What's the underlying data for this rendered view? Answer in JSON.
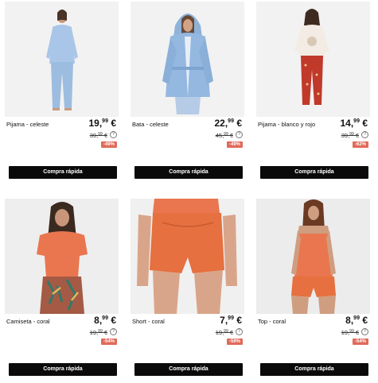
{
  "products": [
    {
      "name": "Pijama - celeste",
      "price_int": "19",
      "price_dec": "99",
      "currency": "€",
      "old_int": "39",
      "old_dec": "99",
      "discount": "-49%",
      "cta": "Compra rápida",
      "help": "?"
    },
    {
      "name": "Bata - celeste",
      "price_int": "22",
      "price_dec": "99",
      "currency": "€",
      "old_int": "45",
      "old_dec": "99",
      "discount": "-49%",
      "cta": "Compra rápida",
      "help": "?"
    },
    {
      "name": "Pijama - blanco y rojo",
      "price_int": "14",
      "price_dec": "99",
      "currency": "€",
      "old_int": "39",
      "old_dec": "99",
      "discount": "-62%",
      "cta": "Compra rápida",
      "help": "?"
    },
    {
      "name": "Camiseta - coral",
      "price_int": "8",
      "price_dec": "99",
      "currency": "€",
      "old_int": "19",
      "old_dec": "99",
      "discount": "-54%",
      "cta": "Compra rápida",
      "help": "?"
    },
    {
      "name": "Short - coral",
      "price_int": "7",
      "price_dec": "99",
      "currency": "€",
      "old_int": "19",
      "old_dec": "99",
      "discount": "-59%",
      "cta": "Compra rápida",
      "help": "?"
    },
    {
      "name": "Top - coral",
      "price_int": "8",
      "price_dec": "99",
      "currency": "€",
      "old_int": "19",
      "old_dec": "99",
      "discount": "-54%",
      "cta": "Compra rápida",
      "help": "?"
    }
  ],
  "colors": {
    "badge": "#e06a5a",
    "button": "#0a0a0a",
    "celeste": "#9dbde0",
    "coral": "#e9764f",
    "red_print": "#c0392b"
  }
}
